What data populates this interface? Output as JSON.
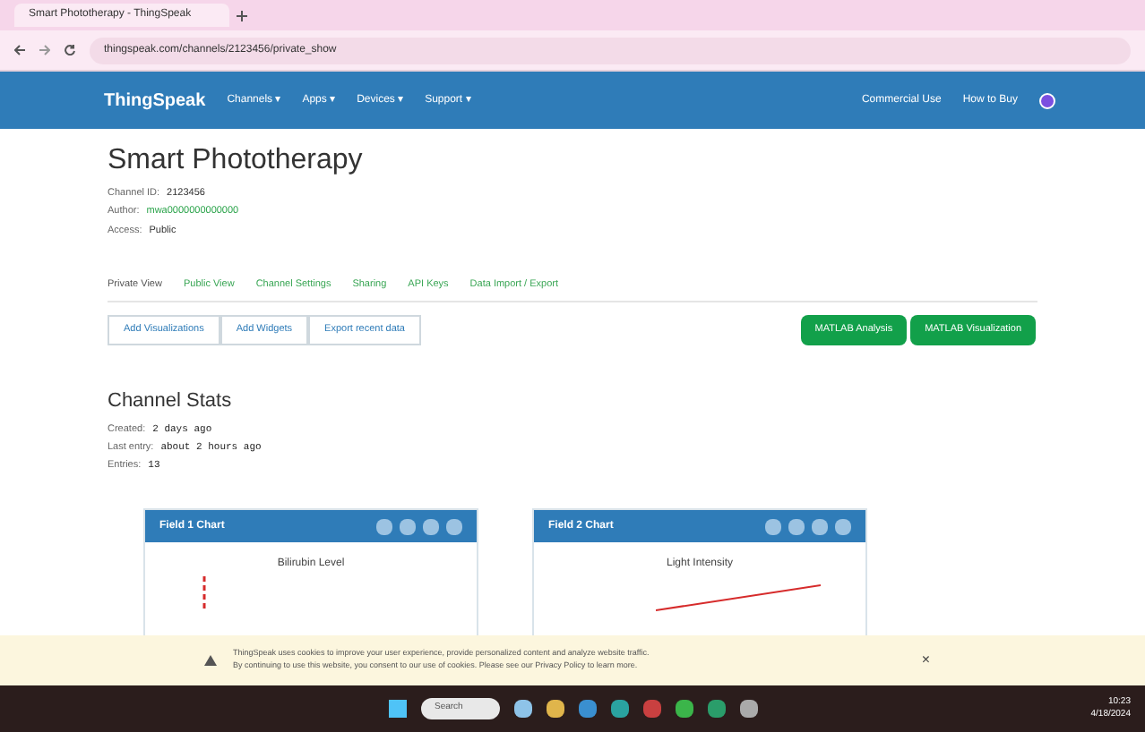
{
  "browser": {
    "tab_title": "Smart Phototherapy - ThingSpeak",
    "url": "thingspeak.com/channels/2123456/private_show"
  },
  "nav": {
    "logo": "ThingSpeak",
    "menu": [
      "Channels ▾",
      "Apps ▾",
      "Devices ▾",
      "Support ▾"
    ],
    "links": [
      "Commercial Use",
      "How to Buy"
    ]
  },
  "channel": {
    "title": "Smart Phototherapy",
    "meta": [
      {
        "label": "Channel ID:",
        "value": "2123456"
      },
      {
        "label": "Author:",
        "value": "mwa0000000000000"
      },
      {
        "label": "Access:",
        "value": "Public"
      }
    ]
  },
  "tabs": [
    {
      "label": "Private View",
      "selected": true
    },
    {
      "label": "Public View",
      "selected": false
    },
    {
      "label": "Channel Settings",
      "selected": false
    },
    {
      "label": "Sharing",
      "selected": false
    },
    {
      "label": "API Keys",
      "selected": false
    },
    {
      "label": "Data Import / Export",
      "selected": false
    }
  ],
  "tool_buttons": [
    "Add Visualizations",
    "Add Widgets",
    "Export recent data"
  ],
  "matlab_buttons": [
    "MATLAB Analysis",
    "MATLAB Visualization"
  ],
  "stats": {
    "title": "Channel Stats",
    "rows": [
      {
        "label": "Created:",
        "value": "2 days ago"
      },
      {
        "label": "Last entry:",
        "value": "about 2 hours ago"
      },
      {
        "label": "Entries:",
        "value": "13"
      }
    ]
  },
  "charts": [
    {
      "header": "Field 1 Chart",
      "title": "Bilirubin Level"
    },
    {
      "header": "Field 2 Chart",
      "title": "Light Intensity"
    }
  ],
  "cookie": {
    "lines": [
      "ThingSpeak uses cookies to improve your user experience, provide personalized content and analyze website traffic.",
      "By continuing to use this website, you consent to our use of cookies. Please see our Privacy Policy to learn more."
    ],
    "close": "×"
  },
  "taskbar": {
    "search": "Search",
    "time": "10:23",
    "date": "4/18/2024"
  }
}
